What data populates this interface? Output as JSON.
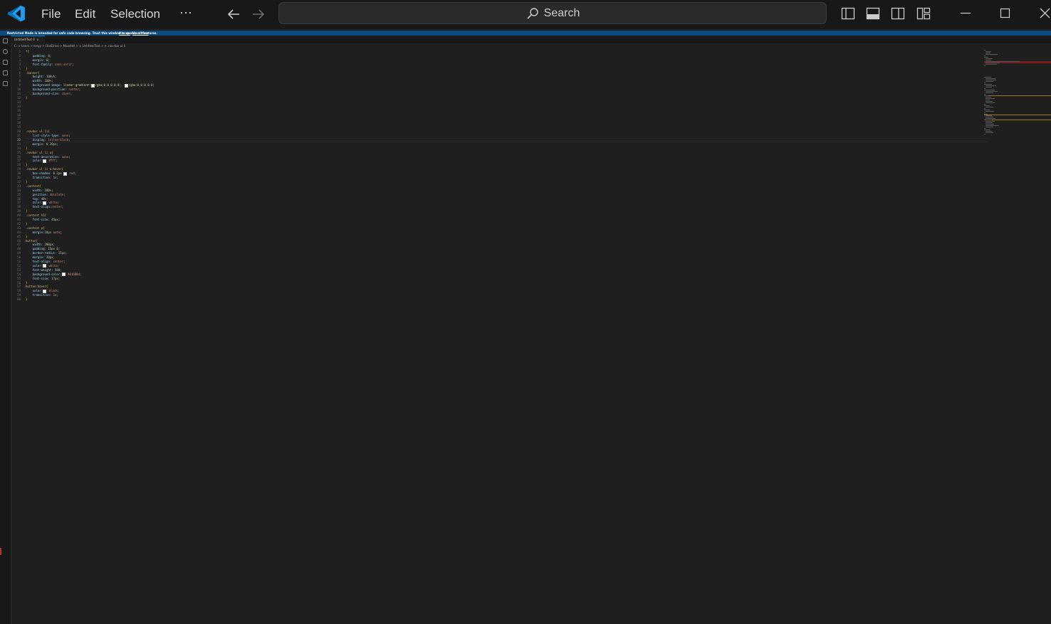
{
  "titlebar": {
    "menu": [
      "File",
      "Edit",
      "Selection"
    ],
    "more": "···",
    "search_label": "Search"
  },
  "banner": {
    "message": "Restricted Mode is intended for safe code browsing. Trust this window to enable all features.",
    "manage": "Manage",
    "learn_more": "Learn More"
  },
  "tab": {
    "label": "Untitled-Text 0",
    "close": "x"
  },
  "breadcrumb": "C: > Users > lenyy > OneDrive > Moodlell > ⊘ Untitled-Text > ⚲ .nav-bar ul li",
  "colors": {
    "accent": "#0078d4",
    "banner_bg": "#0b4a7a",
    "editor_bg": "#1f1f1f"
  },
  "editor": {
    "active_line": 22,
    "lines": [
      {
        "n": "1",
        "t": "*{"
      },
      {
        "n": "2",
        "t": "    padding: 0;"
      },
      {
        "n": "3",
        "t": "    margin: 0;"
      },
      {
        "n": "4",
        "t": "    font-family: sans-serif;"
      },
      {
        "n": "5",
        "t": "}"
      },
      {
        "n": "6",
        "t": ".banner{"
      },
      {
        "n": "7",
        "t": "    height: 100vh;"
      },
      {
        "n": "8",
        "t": "    width: 100%;"
      },
      {
        "n": "9",
        "t": "    background-image: linear-gradient(□rgba(0,0,0,0.8), □rgba(0,0,0,0.8)"
      },
      {
        "n": "10",
        "t": "    background-position: center;"
      },
      {
        "n": "11",
        "t": "    background-size: cover;"
      },
      {
        "n": "12",
        "t": "}"
      },
      {
        "n": "13",
        "t": ""
      },
      {
        "n": "14",
        "t": ""
      },
      {
        "n": "15",
        "t": ""
      },
      {
        "n": "16",
        "t": ""
      },
      {
        "n": "17",
        "t": ""
      },
      {
        "n": "18",
        "t": ""
      },
      {
        "n": "19",
        "t": ""
      },
      {
        "n": "20",
        "t": ".navbar ul li{"
      },
      {
        "n": "21",
        "t": "    list-style-type: none;"
      },
      {
        "n": "22",
        "t": "    display: inline-block;"
      },
      {
        "n": "23",
        "t": "    margin: 0 20px;"
      },
      {
        "n": "24",
        "t": "}"
      },
      {
        "n": "25",
        "t": ".navbar ul li a{"
      },
      {
        "n": "26",
        "t": "    text-decoration: none;"
      },
      {
        "n": "27",
        "t": "    color:□ #fff;"
      },
      {
        "n": "28",
        "t": "}"
      },
      {
        "n": "29",
        "t": ".navbar ul li a:hover{"
      },
      {
        "n": "30",
        "t": "    box-shadow: 0 2px □ red;"
      },
      {
        "n": "31",
        "t": "    transition: 1s;"
      },
      {
        "n": "32",
        "t": "}"
      },
      {
        "n": "33",
        "t": ".content{"
      },
      {
        "n": "34",
        "t": "    width: 100%;"
      },
      {
        "n": "35",
        "t": "    position: absolute;"
      },
      {
        "n": "36",
        "t": "    top: 40%;"
      },
      {
        "n": "37",
        "t": "    color:□ white;"
      },
      {
        "n": "38",
        "t": "    text-align:center;"
      },
      {
        "n": "39",
        "t": "}"
      },
      {
        "n": "40",
        "t": ".content h1{"
      },
      {
        "n": "41",
        "t": "    font-size: 45px;"
      },
      {
        "n": "42",
        "t": "}"
      },
      {
        "n": "43",
        "t": ".content p{"
      },
      {
        "n": "44",
        "t": "    margin:10px auto;"
      },
      {
        "n": "45",
        "t": "}"
      },
      {
        "n": "46",
        "t": "button{"
      },
      {
        "n": "47",
        "t": "    width: 200px;"
      },
      {
        "n": "48",
        "t": "    padding: 15px 0;"
      },
      {
        "n": "49",
        "t": "    border-radius: 15px;"
      },
      {
        "n": "50",
        "t": "    margin: 20px;"
      },
      {
        "n": "51",
        "t": "    text-align: center;"
      },
      {
        "n": "52",
        "t": "    color:□ white;"
      },
      {
        "n": "53",
        "t": "    font-weight: 500;"
      },
      {
        "n": "54",
        "t": "    background-color:□ #01600d;"
      },
      {
        "n": "55",
        "t": "    font-size: 17px;"
      },
      {
        "n": "56",
        "t": "}"
      },
      {
        "n": "57",
        "t": "button:hover{"
      },
      {
        "n": "58",
        "t": "    color:□ black;"
      },
      {
        "n": "59",
        "t": "    transition: 1s;"
      },
      {
        "n": "60",
        "t": "}"
      }
    ]
  }
}
